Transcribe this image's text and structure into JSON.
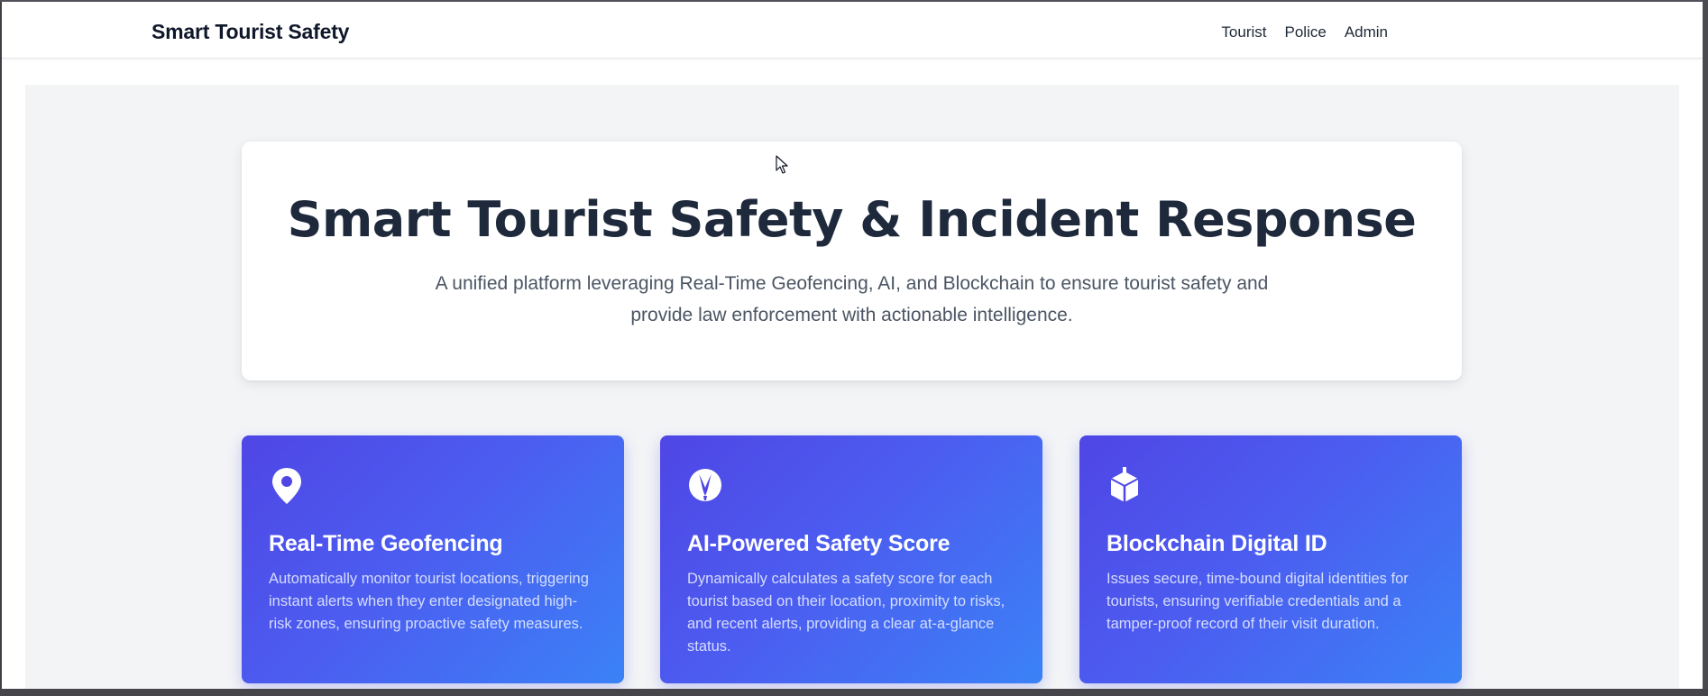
{
  "navbar": {
    "brand": "Smart Tourist Safety",
    "links": [
      {
        "label": "Tourist"
      },
      {
        "label": "Police"
      },
      {
        "label": "Admin"
      }
    ]
  },
  "hero": {
    "title": "Smart Tourist Safety & Incident Response",
    "subtitle": "A unified platform leveraging Real-Time Geofencing, AI, and Blockchain to ensure tourist safety and provide law enforcement with actionable intelligence."
  },
  "features": [
    {
      "icon": "map-pin-icon",
      "title": "Real-Time Geofencing",
      "description": "Automatically monitor tourist locations, triggering instant alerts when they enter designated high-risk zones, ensuring proactive safety measures."
    },
    {
      "icon": "brain-icon",
      "title": "AI-Powered Safety Score",
      "description": "Dynamically calculates a safety score for each tourist based on their location, proximity to risks, and recent alerts, providing a clear at-a-glance status."
    },
    {
      "icon": "cube-icon",
      "title": "Blockchain Digital ID",
      "description": "Issues secure, time-bound digital identities for tourists, ensuring verifiable credentials and a tamper-proof record of their visit duration."
    }
  ],
  "colors": {
    "card_gradient_start": "#4f46e5",
    "card_gradient_end": "#3b82f6",
    "page_background": "#f3f4f6",
    "title_text": "#1e293b"
  }
}
